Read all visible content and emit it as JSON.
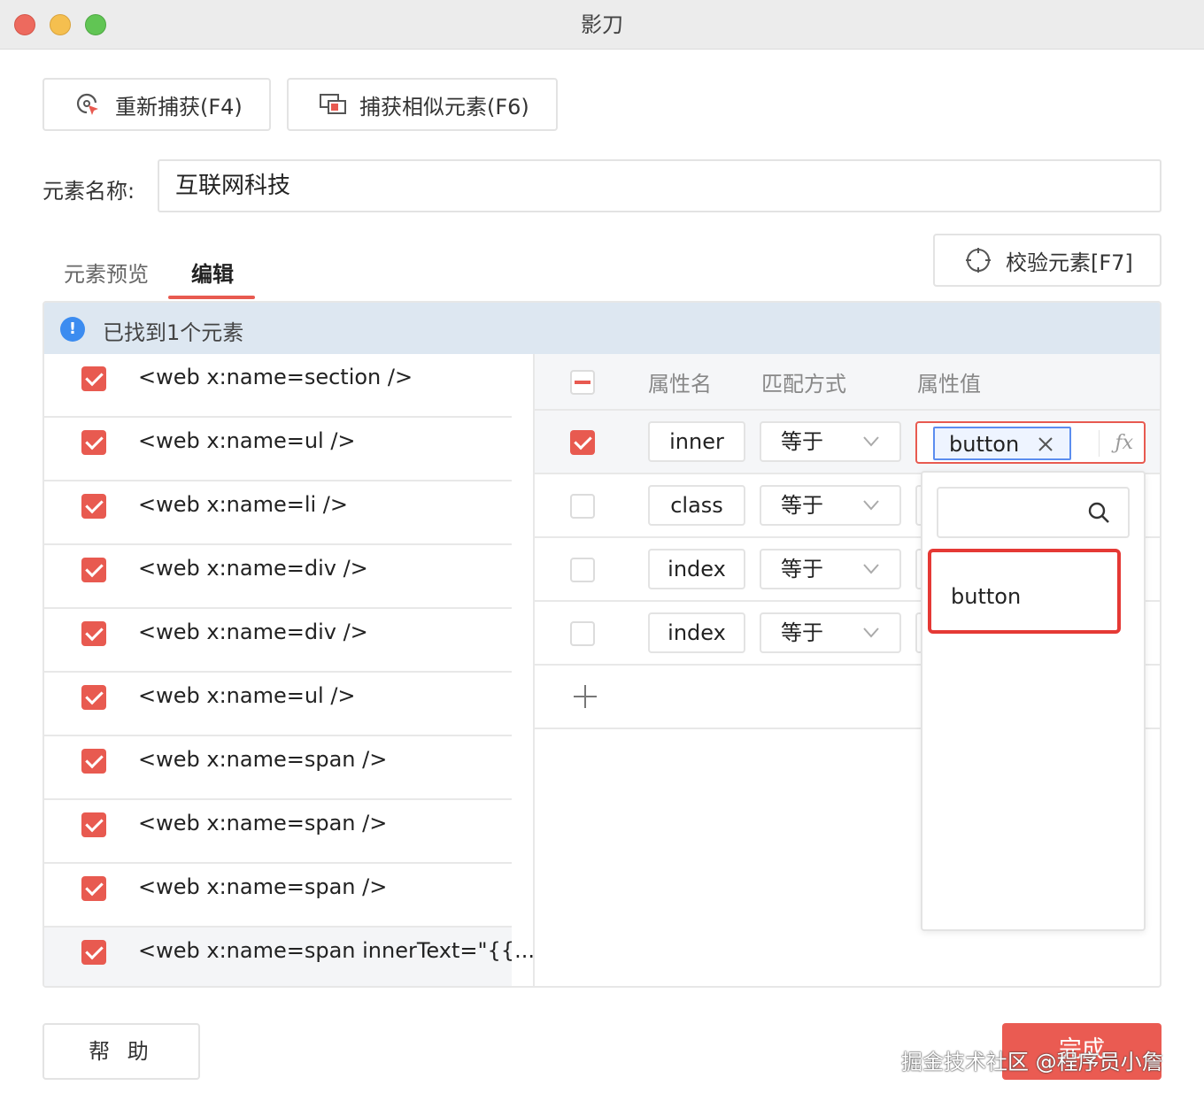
{
  "window": {
    "title": "影刀"
  },
  "toolbar": {
    "recapture_label": "重新捕获(F4)",
    "capture_similar_label": "捕获相似元素(F6)"
  },
  "element_name": {
    "label": "元素名称:",
    "value": "互联网科技"
  },
  "tabs": [
    {
      "label": "元素预览",
      "active": false
    },
    {
      "label": "编辑",
      "active": true
    }
  ],
  "verify_button": {
    "label": "校验元素[F7]"
  },
  "banner": {
    "text": "已找到1个元素"
  },
  "element_list": [
    {
      "text": "<web x:name=section />",
      "checked": true
    },
    {
      "text": "<web x:name=ul />",
      "checked": true
    },
    {
      "text": "<web x:name=li />",
      "checked": true
    },
    {
      "text": "<web x:name=div />",
      "checked": true
    },
    {
      "text": "<web x:name=div />",
      "checked": true
    },
    {
      "text": "<web x:name=ul />",
      "checked": true
    },
    {
      "text": "<web x:name=span />",
      "checked": true
    },
    {
      "text": "<web x:name=span />",
      "checked": true
    },
    {
      "text": "<web x:name=span />",
      "checked": true
    },
    {
      "text": "<web x:name=span innerText=\"{{...",
      "checked": true
    }
  ],
  "attr_table": {
    "headers": {
      "name": "属性名",
      "match": "匹配方式",
      "value": "属性值"
    },
    "rows": [
      {
        "checked": true,
        "name": "inner",
        "match": "等于"
      },
      {
        "checked": false,
        "name": "class",
        "match": "等于"
      },
      {
        "checked": false,
        "name": "index",
        "match": "等于"
      },
      {
        "checked": false,
        "name": "index",
        "match": "等于"
      }
    ],
    "value_tag": "button",
    "fx_label": "ƒx"
  },
  "dropdown": {
    "search_placeholder": "",
    "options": [
      "button"
    ]
  },
  "footer": {
    "help_label": "帮 助",
    "done_label": "完成"
  },
  "watermark": "掘金技术社区 @程序员小詹",
  "colors": {
    "accent": "#e85a50",
    "info": "#3c8cf0",
    "banner_bg": "#dde7f1",
    "tag_border": "#5b8def"
  }
}
